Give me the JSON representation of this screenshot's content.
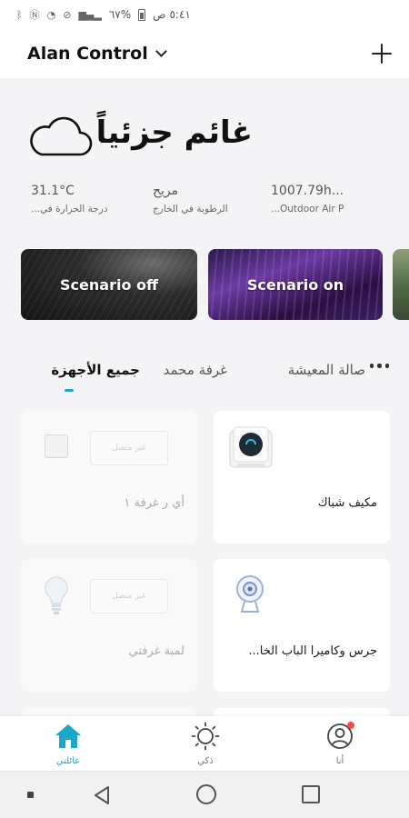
{
  "status_bar": {
    "time": "٥:٤١ ص",
    "battery": "%٦٧"
  },
  "header": {
    "home_name": "Alan Control"
  },
  "weather": {
    "condition": "غائم جزئياً",
    "temperature": {
      "value": "31.1°C",
      "label": "درجة الحرارة في..."
    },
    "humidity": {
      "value": "مريح",
      "label": "الرطوبة في الخارج"
    },
    "pressure": {
      "value": "1007.79h...",
      "label": "Outdoor Air P..."
    }
  },
  "scenarios": [
    {
      "label": "Scenario off"
    },
    {
      "label": "Scenario on"
    }
  ],
  "tabs": {
    "all": "جميع الأجهزة",
    "room_mohammed": "غرفة محمد",
    "living_room": "صالة المعيشة"
  },
  "devices": [
    {
      "name": "أي ر غرفة ١",
      "status": "غير متصل",
      "online": false,
      "icon": "sensor-icon"
    },
    {
      "name": "مكيف شباك",
      "online": true,
      "icon": "air-conditioner-icon"
    },
    {
      "name": "لمبة غرفتي",
      "status": "غير متصل",
      "online": false,
      "icon": "bulb-icon"
    },
    {
      "name": "جرس وكاميرا الباب الخا...",
      "online": true,
      "icon": "doorbell-camera-icon"
    }
  ],
  "bottom_nav": {
    "home": "عائلتي",
    "smart": "ذكي",
    "me": "أنا"
  },
  "colors": {
    "accent": "#1aa7c9",
    "notification": "#ff4a4a"
  }
}
